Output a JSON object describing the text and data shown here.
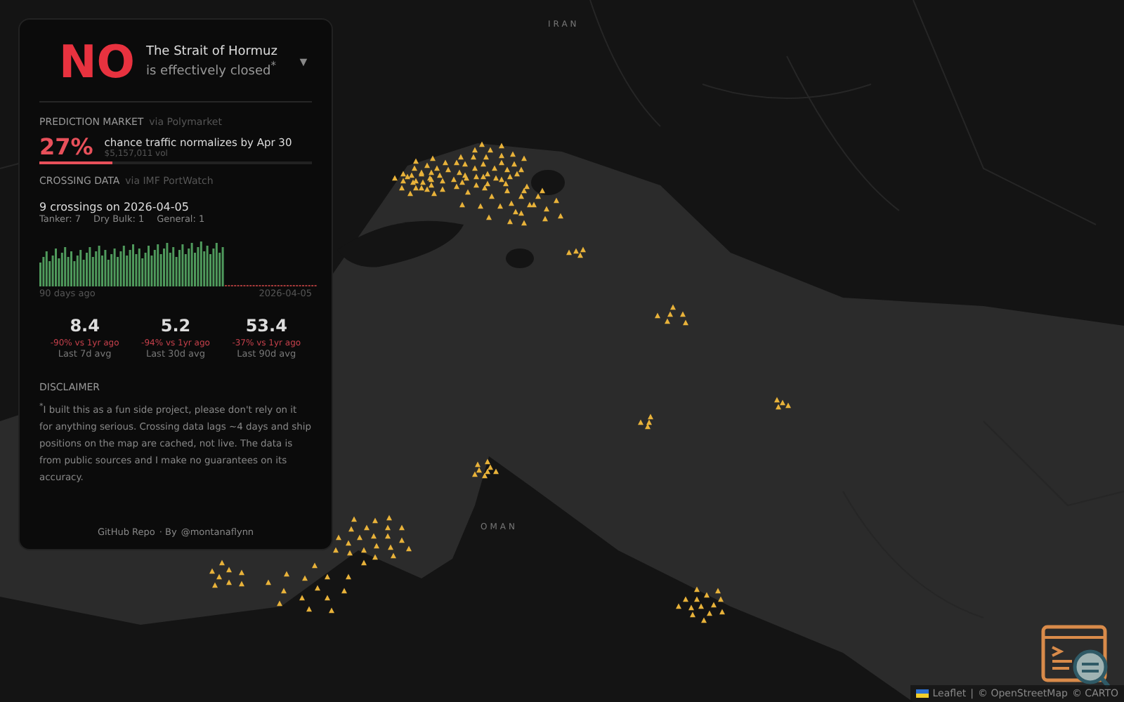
{
  "map": {
    "labels": [
      {
        "text": "IRAN"
      },
      {
        "text": "OMAN"
      }
    ],
    "attribution": {
      "leaflet": "Leaflet",
      "separator": "|",
      "osm": "© OpenStreetMap",
      "carto": "© CARTO"
    }
  },
  "headline": {
    "answer": "NO",
    "line1": "The Strait of Hormuz",
    "line2": "is effectively closed$^{*}$",
    "toggle": "▼"
  },
  "prediction": {
    "heading": "PREDICTION MARKET",
    "source": "via Polymarket",
    "percent": "27%",
    "text": "chance traffic normalizes by Apr 30",
    "volume": "$5,157,011 vol",
    "level": 0.27
  },
  "crossing": {
    "heading": "CROSSING DATA",
    "source": "via IMF PortWatch",
    "summary": "9 crossings on 2026-04-05",
    "breakdown": [
      {
        "label": "Tanker:",
        "value": "7"
      },
      {
        "label": "Dry Bulk:",
        "value": "1"
      },
      {
        "label": "General:",
        "value": "1"
      }
    ],
    "axis_start": "90 days ago",
    "axis_end": "2026-04-05"
  },
  "stats": [
    {
      "value": "8.4",
      "change": "-90% vs 1yr ago",
      "label": "Last 7d avg"
    },
    {
      "value": "5.2",
      "change": "-94% vs 1yr ago",
      "label": "Last 30d avg"
    },
    {
      "value": "53.4",
      "change": "-37% vs 1yr ago",
      "label": "Last 90d avg"
    }
  ],
  "disclaimer": {
    "heading": "DISCLAIMER",
    "text": "$^{*}$I built this as a fun side project, please don't rely on it for anything serious. Crossing data lags ~4 days and ship positions on the map are cached, not live. The data is from public sources and I make no guarantees on its accuracy."
  },
  "footer": {
    "repo_link": "GitHub Repo",
    "middle": "· By",
    "author_link": "@montanaflynn"
  }
}
